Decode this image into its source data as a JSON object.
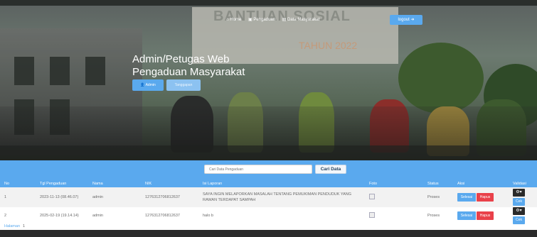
{
  "nav": {
    "home": "Home",
    "pengaduan": "Pengaduan",
    "data_masyarakat": "Data Masyarakat",
    "logout": "logout"
  },
  "hero": {
    "title_line1": "Admin/Petugas Web",
    "title_line2": "Pengaduan Masyarakat",
    "btn_admin": "Admin",
    "btn_tanggapan": "Tanggapan",
    "banner_text": "BANTUAN SOSIAL",
    "banner_sub": "TAHUN 2022"
  },
  "search": {
    "placeholder": "Cari Data Pengaduan",
    "button": "Cari Data"
  },
  "table": {
    "headers": [
      "No",
      "Tgl Pengaduan",
      "Nama",
      "NIK",
      "Isi Laporan",
      "Foto",
      "Status",
      "Aksi",
      "Validasi"
    ],
    "rows": [
      {
        "no": "1",
        "tgl": "2023-11-13 (08.46.07)",
        "nama": "admin",
        "nik": "1276312706812637",
        "isi": "SAYA INGIN MELAPORKAN MASALAH TENTANG PEMUKIMAN PENDUDUK YANG RAWAN TERDAPAT SAMPAH",
        "status": "Proses",
        "btn_selesai": "Selesai",
        "btn_hapus": "Hapus",
        "btn_cek": "Cek"
      },
      {
        "no": "2",
        "tgl": "2025-02-19 (19.14.14)",
        "nama": "admin",
        "nik": "1276312706812637",
        "isi": "halo b",
        "status": "Proses",
        "btn_selesai": "Selesai",
        "btn_hapus": "Hapus",
        "btn_cek": "Cek"
      }
    ]
  },
  "pagination": {
    "label": "Halaman",
    "page": "1"
  },
  "colors": {
    "primary": "#5aa9ee",
    "danger": "#e9414a",
    "dark": "#2a2a2a"
  }
}
